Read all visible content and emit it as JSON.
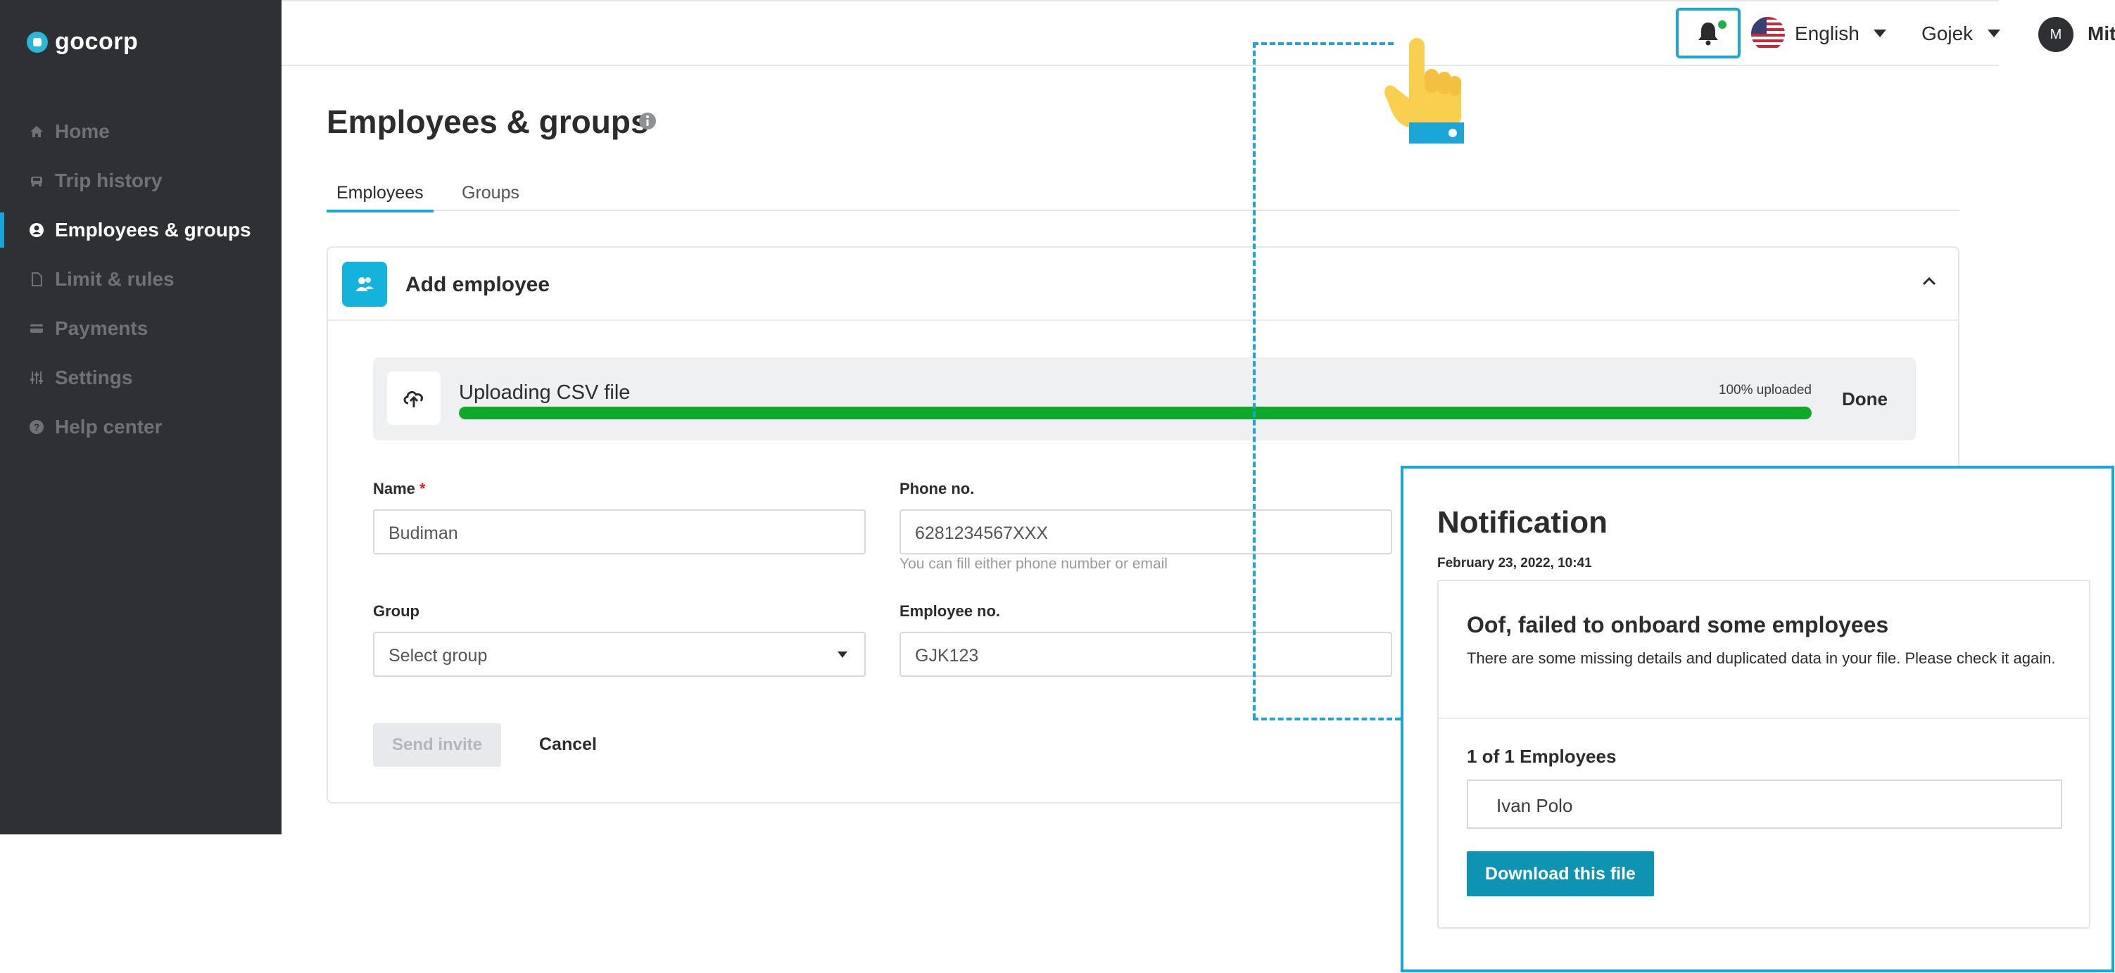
{
  "brand": {
    "name": "gocorp",
    "accent": "#1aa7d8",
    "sidebar_bg": "#2e3034"
  },
  "sidebar": {
    "items": [
      {
        "label": "Home",
        "icon": "home-icon",
        "active": false
      },
      {
        "label": "Trip history",
        "icon": "car-icon",
        "active": false
      },
      {
        "label": "Employees & groups",
        "icon": "user-icon",
        "active": true
      },
      {
        "label": "Limit & rules",
        "icon": "document-icon",
        "active": false
      },
      {
        "label": "Payments",
        "icon": "card-icon",
        "active": false
      },
      {
        "label": "Settings",
        "icon": "sliders-icon",
        "active": false
      },
      {
        "label": "Help center",
        "icon": "help-icon",
        "active": false
      }
    ]
  },
  "topbar": {
    "language": "English",
    "company": "Gojek",
    "avatar_initial": "M",
    "user_name": "Mitsalina",
    "notification_indicator_color": "#21b14a"
  },
  "page": {
    "title": "Employees & groups",
    "tabs": [
      {
        "label": "Employees",
        "active": true
      },
      {
        "label": "Groups",
        "active": false
      }
    ]
  },
  "add_employee": {
    "title": "Add employee",
    "upload": {
      "label": "Uploading CSV file",
      "status": "100% uploaded",
      "progress": 1.0,
      "done_label": "Done"
    },
    "form": {
      "name_label": "Name",
      "name_required_mark": "*",
      "name_value": "Budiman",
      "phone_label": "Phone no.",
      "phone_value": "6281234567XXX",
      "phone_hint": "You can fill either phone number or email",
      "group_label": "Group",
      "group_value": "Select group",
      "employee_no_label": "Employee no.",
      "employee_no_value": "GJK123"
    },
    "send_label": "Send invite",
    "cancel_label": "Cancel"
  },
  "notification": {
    "title": "Notification",
    "timestamp": "February 23, 2022, 10:41",
    "message_title": "Oof, failed to onboard some employees",
    "message_body": "There are some missing details and duplicated data in your file. Please check it again.",
    "count_label": "1 of 1 Employees",
    "employees": [
      "Ivan Polo"
    ],
    "download_label": "Download this file"
  }
}
